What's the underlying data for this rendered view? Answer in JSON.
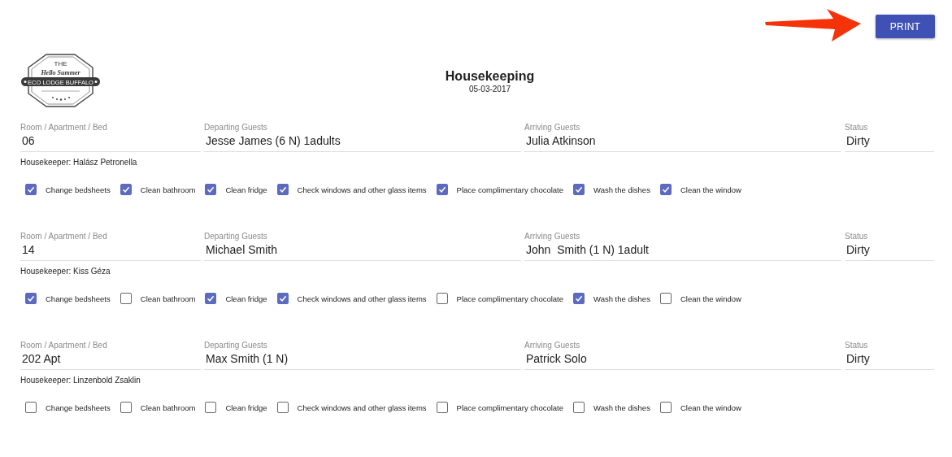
{
  "toolbar": {
    "print_button": "PRINT"
  },
  "logo": {
    "top": "THE",
    "script": "Hello Summer",
    "banner": "ECO LODGE BUFFALO"
  },
  "header": {
    "title": "Housekeeping",
    "date": "05-03-2017"
  },
  "records": [
    {
      "fields": [
        {
          "label": "Room / Apartment / Bed",
          "value": "06"
        },
        {
          "label": "Departing Guests",
          "value": "Jesse James (6 N) 1adults"
        },
        {
          "label": "Arriving Guests",
          "value": "Julia Atkinson"
        },
        {
          "label": "Status",
          "value": "Dirty"
        }
      ],
      "housekeeper": "Housekeeper: Halász Petronella",
      "tasks": [
        {
          "label": "Change bedsheets",
          "checked": true
        },
        {
          "label": "Clean bathroom",
          "checked": true
        },
        {
          "label": "Clean fridge",
          "checked": true
        },
        {
          "label": "Check windows and other glass items",
          "checked": true
        },
        {
          "label": "Place complimentary chocolate",
          "checked": true
        },
        {
          "label": "Wash the dishes",
          "checked": true
        },
        {
          "label": "Clean the window",
          "checked": true
        }
      ]
    },
    {
      "fields": [
        {
          "label": "Room / Apartment / Bed",
          "value": "14"
        },
        {
          "label": "Departing Guests",
          "value": "Michael Smith"
        },
        {
          "label": "Arriving Guests",
          "value": "John  Smith (1 N) 1adult"
        },
        {
          "label": "Status",
          "value": "Dirty"
        }
      ],
      "housekeeper": "Housekeeper: Kiss Géza",
      "tasks": [
        {
          "label": "Change bedsheets",
          "checked": true
        },
        {
          "label": "Clean bathroom",
          "checked": false
        },
        {
          "label": "Clean fridge",
          "checked": true
        },
        {
          "label": "Check windows and other glass items",
          "checked": true
        },
        {
          "label": "Place complimentary chocolate",
          "checked": false
        },
        {
          "label": "Wash the dishes",
          "checked": true
        },
        {
          "label": "Clean the window",
          "checked": false
        }
      ]
    },
    {
      "fields": [
        {
          "label": "Room / Apartment / Bed",
          "value": "202 Apt"
        },
        {
          "label": "Departing Guests",
          "value": "Max Smith (1 N)"
        },
        {
          "label": "Arriving Guests",
          "value": "Patrick Solo"
        },
        {
          "label": "Status",
          "value": "Dirty"
        }
      ],
      "housekeeper": "Housekeeper: Linzenbold Zsaklin",
      "tasks": [
        {
          "label": "Change bedsheets",
          "checked": false
        },
        {
          "label": "Clean bathroom",
          "checked": false
        },
        {
          "label": "Clean fridge",
          "checked": false
        },
        {
          "label": "Check windows and other glass items",
          "checked": false
        },
        {
          "label": "Place complimentary chocolate",
          "checked": false
        },
        {
          "label": "Wash the dishes",
          "checked": false
        },
        {
          "label": "Clean the window",
          "checked": false
        }
      ]
    }
  ]
}
